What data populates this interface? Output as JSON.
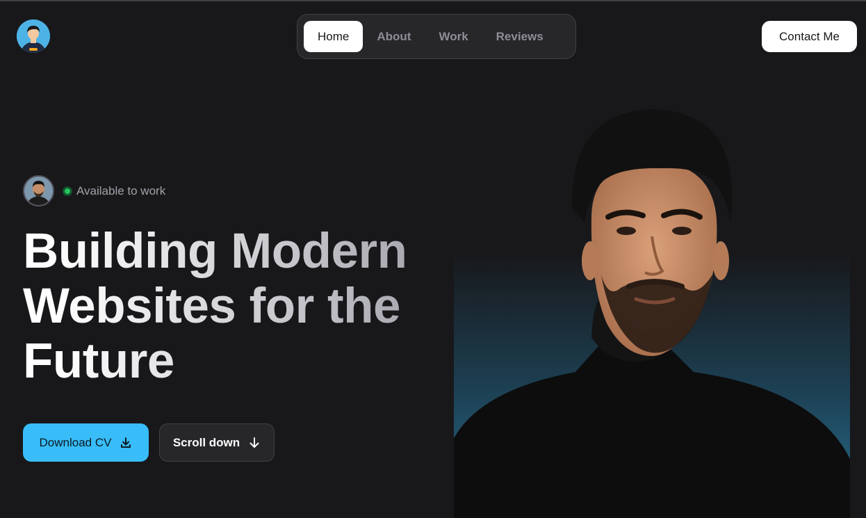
{
  "header": {
    "logo_alt": "avatar",
    "nav": [
      {
        "label": "Home",
        "active": true
      },
      {
        "label": "About",
        "active": false
      },
      {
        "label": "Work",
        "active": false
      },
      {
        "label": "Reviews",
        "active": false
      }
    ],
    "contact_label": "Contact Me"
  },
  "hero": {
    "status_text": "Available to work",
    "title_line1": "Building Modern",
    "title_line2": "Websites for the",
    "title_line3": "Future",
    "download_label": "Download CV",
    "scroll_label": "Scroll down",
    "icons": {
      "download": "download-icon",
      "scroll": "arrow-down-icon",
      "status": "status-dot-icon"
    }
  },
  "colors": {
    "background": "#18181b",
    "accent": "#38bdf8",
    "status": "#22c55e",
    "nav_bg": "#27272a"
  }
}
